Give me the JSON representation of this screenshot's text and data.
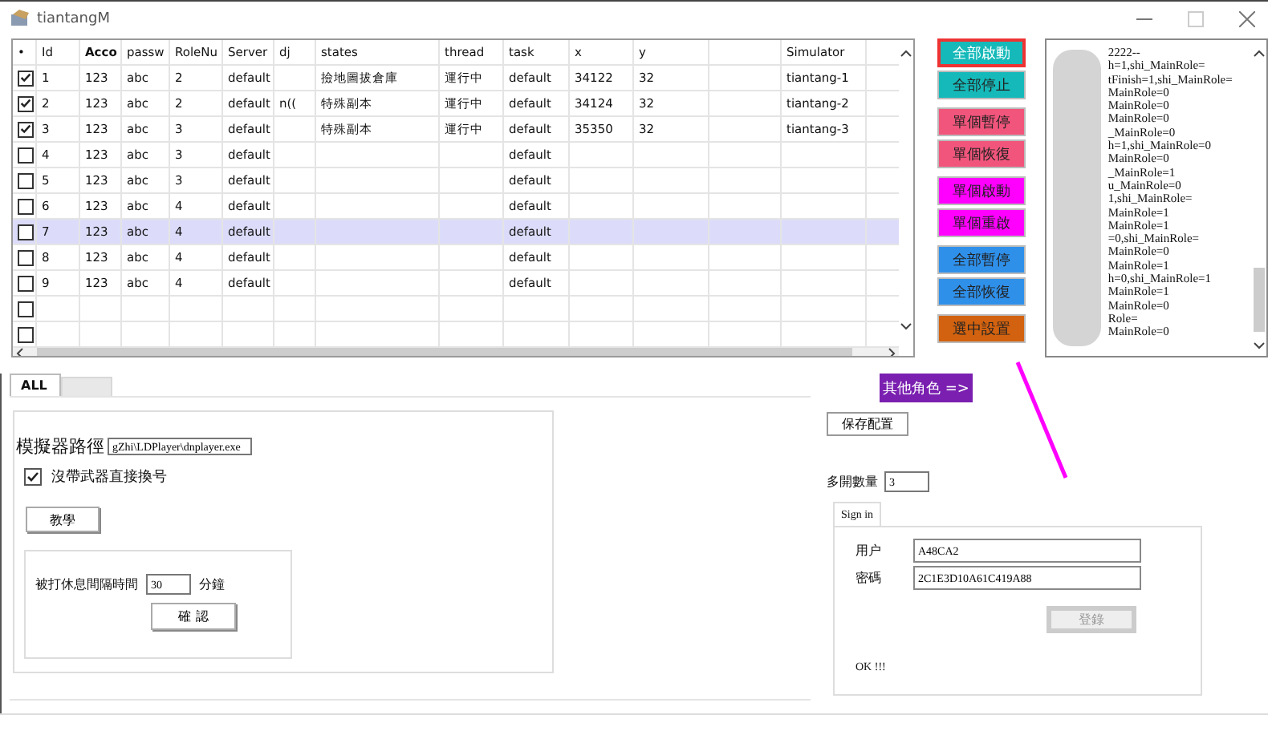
{
  "window": {
    "title": "tiantangM"
  },
  "grid": {
    "columns": [
      {
        "label": "•",
        "bold": false
      },
      {
        "label": "Id",
        "bold": false
      },
      {
        "label": "Acco",
        "bold": true
      },
      {
        "label": "passw",
        "bold": false
      },
      {
        "label": "RoleNu",
        "bold": false
      },
      {
        "label": "Server",
        "bold": false
      },
      {
        "label": "dj",
        "bold": false
      },
      {
        "label": "states",
        "bold": false
      },
      {
        "label": "thread",
        "bold": false
      },
      {
        "label": "task",
        "bold": false
      },
      {
        "label": "x",
        "bold": false
      },
      {
        "label": "y",
        "bold": false
      },
      {},
      {
        "label": "Simulator",
        "bold": false
      },
      {}
    ],
    "rows": [
      {
        "checked": true,
        "selected": false,
        "cells": [
          null,
          "1",
          "123",
          "abc",
          "2",
          "default",
          null,
          "撿地圖拔倉庫",
          "運行中",
          "default",
          "34122",
          "32",
          null,
          "tiantang-1",
          null
        ]
      },
      {
        "checked": true,
        "selected": false,
        "cells": [
          null,
          "2",
          "123",
          "abc",
          "2",
          "default",
          "n((",
          "特殊副本",
          "運行中",
          "default",
          "34124",
          "32",
          null,
          "tiantang-2",
          null
        ]
      },
      {
        "checked": true,
        "selected": false,
        "cells": [
          null,
          "3",
          "123",
          "abc",
          "3",
          "default",
          null,
          "特殊副本",
          "運行中",
          "default",
          "35350",
          "32",
          null,
          "tiantang-3",
          null
        ]
      },
      {
        "checked": false,
        "selected": false,
        "cells": [
          null,
          "4",
          "123",
          "abc",
          "3",
          "default",
          null,
          null,
          null,
          "default"
        ]
      },
      {
        "checked": false,
        "selected": false,
        "cells": [
          null,
          "5",
          "123",
          "abc",
          "3",
          "default",
          null,
          null,
          null,
          "default"
        ]
      },
      {
        "checked": false,
        "selected": false,
        "cells": [
          null,
          "6",
          "123",
          "abc",
          "4",
          "default",
          null,
          null,
          null,
          "default"
        ]
      },
      {
        "checked": false,
        "selected": true,
        "cells": [
          null,
          "7",
          "123",
          "abc",
          "4",
          "default",
          null,
          null,
          null,
          "default"
        ]
      },
      {
        "checked": false,
        "selected": false,
        "cells": [
          null,
          "8",
          "123",
          "abc",
          "4",
          "default",
          null,
          null,
          null,
          "default"
        ]
      },
      {
        "checked": false,
        "selected": false,
        "cells": [
          null,
          "9",
          "123",
          "abc",
          "4",
          "default",
          null,
          null,
          null,
          "default"
        ]
      },
      {
        "checked": false,
        "selected": false
      },
      {
        "checked": false,
        "selected": false
      }
    ]
  },
  "action_buttons": [
    {
      "label": "全部啟動",
      "color": "#16b9b9",
      "focused": true
    },
    {
      "label": "全部停止",
      "color": "#16b9b9",
      "focused": false
    },
    {
      "label": "單個暫停",
      "color": "#f2557c",
      "focused": false
    },
    {
      "label": "單個恢復",
      "color": "#f2557c",
      "focused": false
    },
    {
      "label": "單個啟動",
      "color": "#ff00ff",
      "focused": false
    },
    {
      "label": "單個重啟",
      "color": "#ff00ff",
      "focused": false
    },
    {
      "label": "全部暫停",
      "color": "#2f90ea",
      "focused": false
    },
    {
      "label": "全部恢復",
      "color": "#2f90ea",
      "focused": false
    },
    {
      "label": "選中設置",
      "color": "#d2620f",
      "focused": false
    }
  ],
  "log": [
    "2222--",
    "h=1,shi_MainRole=",
    "tFinish=1,shi_MainRole=",
    "MainRole=0",
    "MainRole=0",
    "MainRole=0",
    "_MainRole=0",
    "h=1,shi_MainRole=0",
    "MainRole=0",
    "_MainRole=1",
    "u_MainRole=0",
    "1,shi_MainRole=",
    "MainRole=1",
    "MainRole=1",
    "=0,shi_MainRole=",
    "MainRole=0",
    "MainRole=1",
    "h=0,shi_MainRole=1",
    "MainRole=1",
    "MainRole=0",
    "Role=",
    "MainRole=0"
  ],
  "tabs": [
    {
      "label": "ALL",
      "selected": true
    },
    {
      "selected": false
    }
  ],
  "settings": {
    "path_label": "模擬器路徑",
    "path_value": "gZhi\\LDPlayer\\dnplayer.exe",
    "checkbox": {
      "label": "沒帶武器直接換号",
      "checked": true
    },
    "tutorial_button": "教學",
    "rest_label": "被打休息間隔時間",
    "rest_value": "30",
    "rest_unit": "分鐘",
    "confirm_button": "確 認"
  },
  "other_roles_button": "其他角色 =>",
  "save_button": "保存配置",
  "instances": {
    "label": "多開數量",
    "value": "3"
  },
  "sign_in": {
    "tab": "Sign in",
    "user_label": "用户",
    "user_value": "A48CA2",
    "password_label": "密碼",
    "password_value": "2C1E3D10A61C419A88",
    "login_button": "登錄",
    "login_disabled": true,
    "status": "OK !!!"
  }
}
